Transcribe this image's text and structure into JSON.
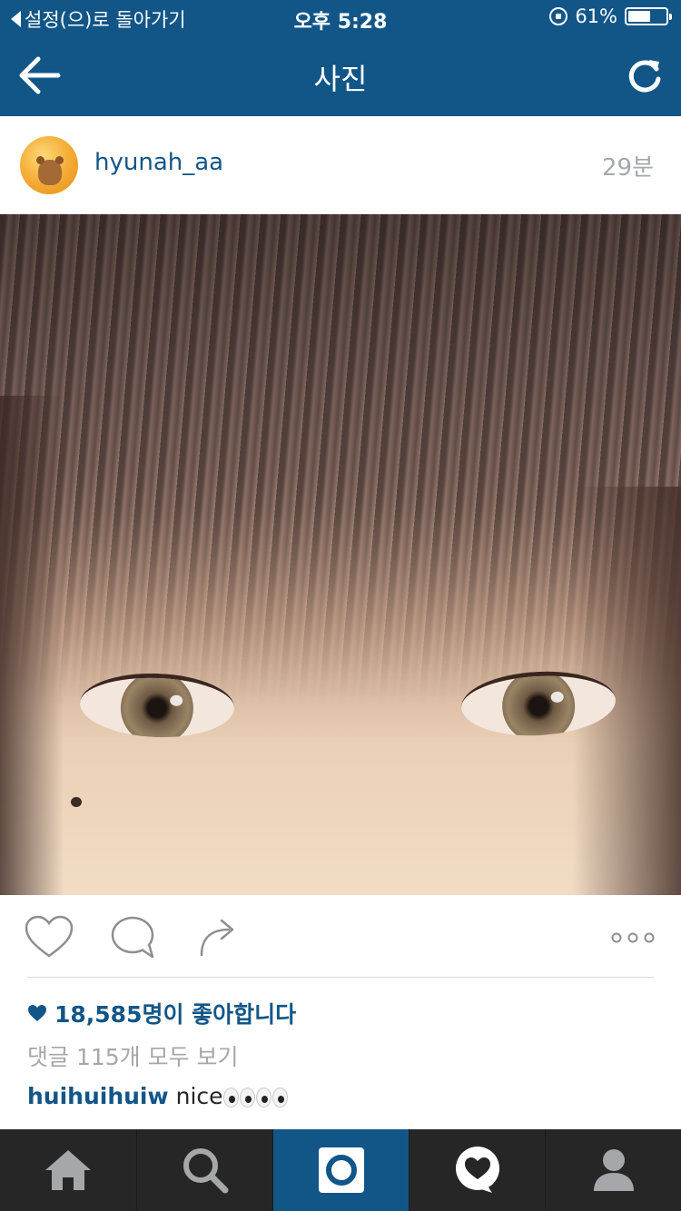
{
  "status_bar": {
    "back_label": "설정(으)로 돌아가기",
    "time": "오후 5:28",
    "battery_text": "61%",
    "battery_level": 0.61
  },
  "nav": {
    "title": "사진",
    "back_icon": "back-arrow-icon",
    "refresh_icon": "refresh-icon"
  },
  "post": {
    "username": "hyunah_aa",
    "time_ago": "29분",
    "likes_text": "18,585명이 좋아합니다",
    "view_comments": "댓글 115개 모두 보기",
    "comments": [
      {
        "user": "huihuihuiw",
        "text": "nice"
      }
    ]
  },
  "tabs": [
    {
      "name": "home",
      "icon": "home-icon",
      "active": false
    },
    {
      "name": "search",
      "icon": "search-icon",
      "active": false
    },
    {
      "name": "camera",
      "icon": "camera-icon",
      "active": true
    },
    {
      "name": "activity",
      "icon": "heart-bubble-icon",
      "active": false
    },
    {
      "name": "profile",
      "icon": "person-icon",
      "active": false
    }
  ],
  "colors": {
    "brand_blue": "#125688",
    "tabbar_bg": "#262626",
    "muted_text": "#a5a7aa"
  }
}
